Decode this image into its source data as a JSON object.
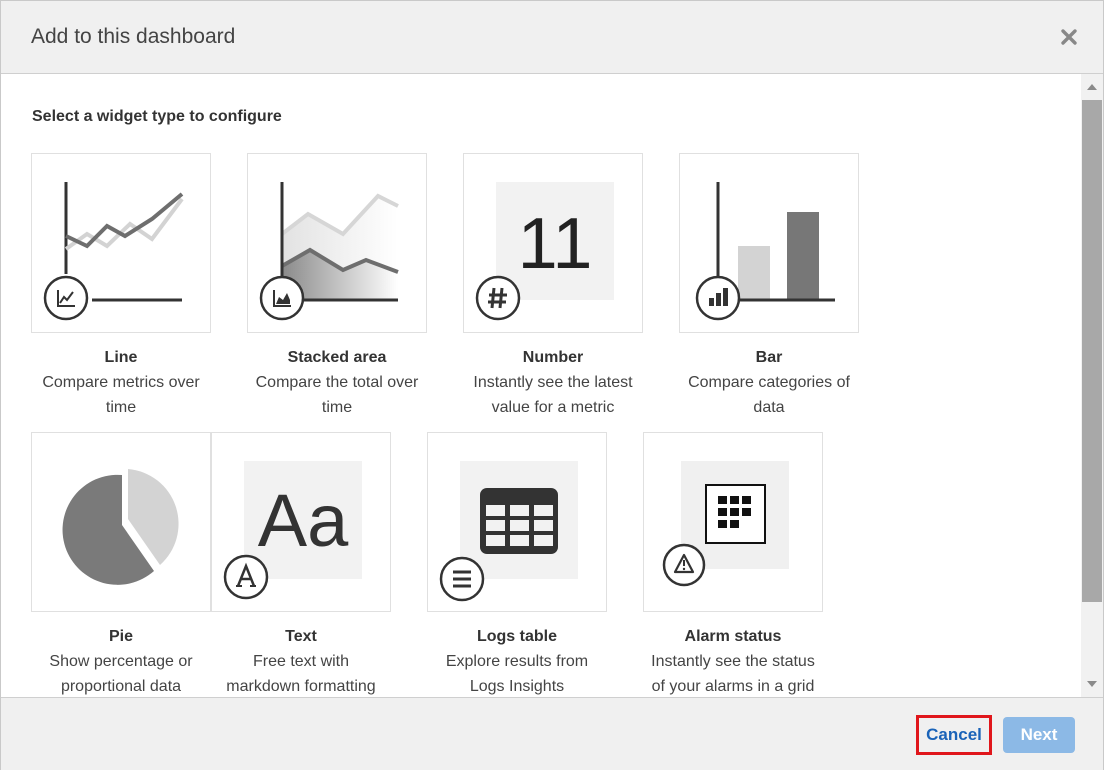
{
  "dialog": {
    "title": "Add to this dashboard",
    "close_icon": "close-icon"
  },
  "content": {
    "subtitle": "Select a widget type to configure",
    "widgets": [
      {
        "name": "Line",
        "desc1": "Compare metrics over",
        "desc2": "time",
        "icon": "line-chart-icon"
      },
      {
        "name": "Stacked area",
        "desc1": "Compare the total over",
        "desc2": "time",
        "icon": "area-chart-icon"
      },
      {
        "name": "Number",
        "desc1": "Instantly see the latest",
        "desc2": "value for a metric",
        "icon": "hash-icon",
        "sample_value": "11"
      },
      {
        "name": "Bar",
        "desc1": "Compare categories of",
        "desc2": "data",
        "icon": "bar-chart-icon"
      },
      {
        "name": "Pie",
        "desc1": "Show percentage or",
        "desc2": "proportional data",
        "icon": "pie-chart-icon"
      },
      {
        "name": "Text",
        "desc1": "Free text with",
        "desc2": "markdown formatting",
        "icon": "font-icon",
        "sample_text": "Aa"
      },
      {
        "name": "Logs table",
        "desc1": "Explore results from",
        "desc2": "Logs Insights",
        "icon": "list-icon"
      },
      {
        "name": "Alarm status",
        "desc1": "Instantly see the status",
        "desc2": "of your alarms in a grid",
        "icon": "warning-icon"
      }
    ]
  },
  "footer": {
    "cancel_label": "Cancel",
    "next_label": "Next"
  },
  "colors": {
    "cancel_highlight": "#e0161b",
    "link_blue": "#1a63b8",
    "next_disabled": "#8cb9e6"
  }
}
